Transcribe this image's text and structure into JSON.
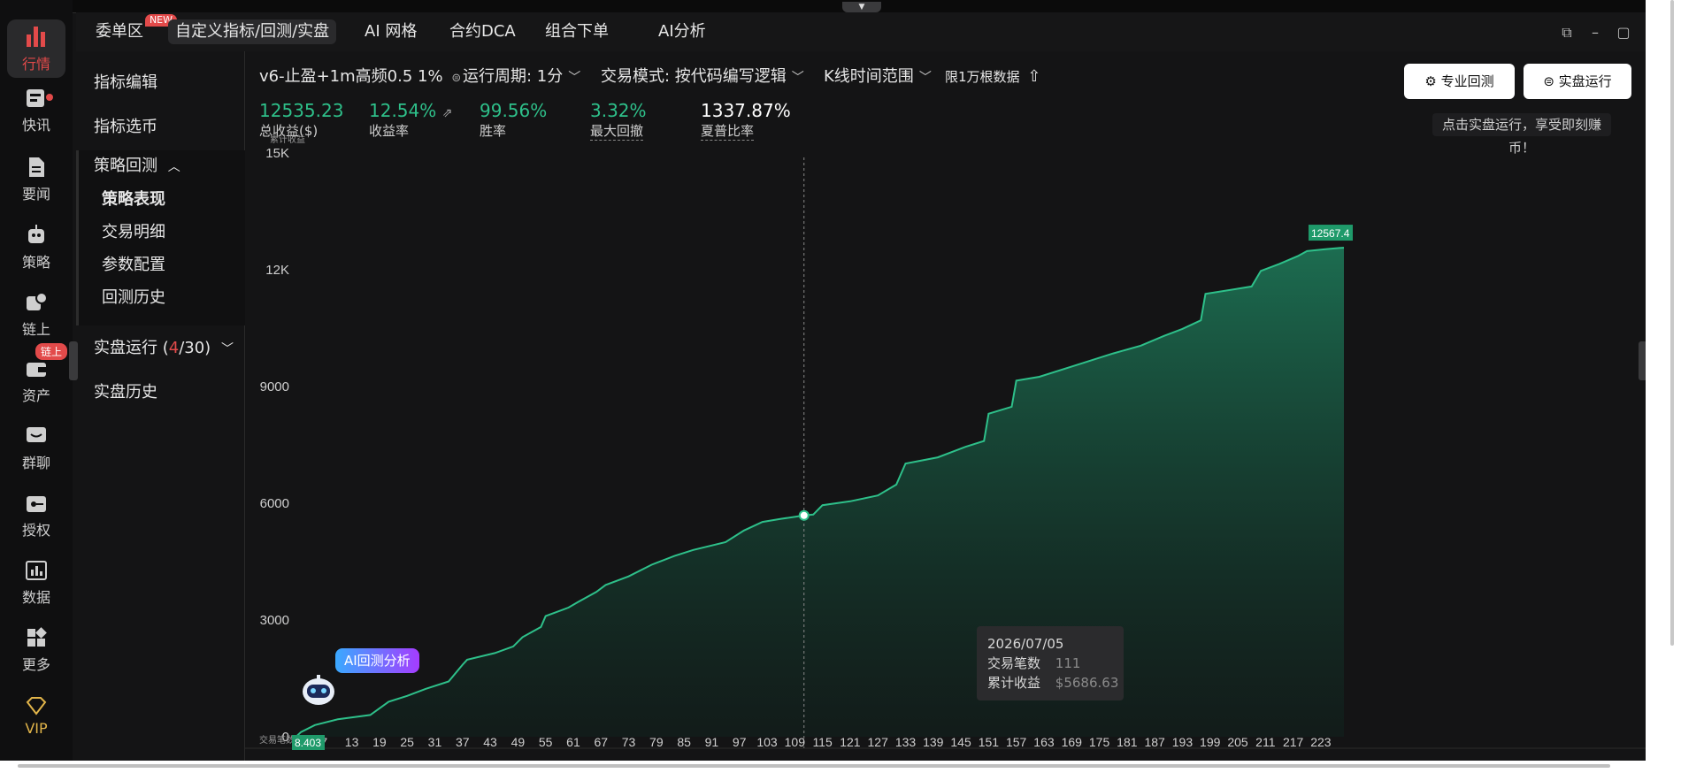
{
  "rail": {
    "items": [
      {
        "label": "行情",
        "icon": "bar-chart-icon",
        "active": true
      },
      {
        "label": "快讯",
        "icon": "news-icon",
        "dot": true
      },
      {
        "label": "要闻",
        "icon": "document-icon"
      },
      {
        "label": "策略",
        "icon": "robot-icon"
      },
      {
        "label": "链上",
        "icon": "chain-icon"
      },
      {
        "label": "资产",
        "icon": "wallet-icon",
        "badge": "链上"
      },
      {
        "label": "群聊",
        "icon": "chat-icon"
      },
      {
        "label": "授权",
        "icon": "key-icon"
      },
      {
        "label": "数据",
        "icon": "data-icon"
      },
      {
        "label": "更多",
        "icon": "grid-icon"
      },
      {
        "label": "VIP",
        "icon": "diamond-icon"
      }
    ]
  },
  "tabs": [
    {
      "label": "委单区",
      "badge": "NEW"
    },
    {
      "label": "自定义指标/回测/实盘",
      "active": true
    },
    {
      "label": "AI 网格"
    },
    {
      "label": "合约DCA"
    },
    {
      "label": "组合下单"
    },
    {
      "label": "AI分析"
    }
  ],
  "leftnav": {
    "indicator_edit": "指标编辑",
    "indicator_pick": "指标选币",
    "backtest": "策略回测",
    "backtest_subs": [
      "策略表现",
      "交易明细",
      "参数配置",
      "回测历史"
    ],
    "live_run": "实盘运行 (",
    "live_count": "4",
    "live_total": "/30)",
    "live_history": "实盘历史"
  },
  "controls": {
    "strategy": "v6-止盈+1m高频0.5 1%",
    "period": "运行周期: 1分",
    "mode": "交易模式: 按代码编写逻辑",
    "kline_range": "K线时间范围",
    "limit": "限1万根数据"
  },
  "buttons": {
    "pro_backtest": "专业回测",
    "live_run": "实盘运行",
    "hint": "点击实盘运行，享受即刻赚币！"
  },
  "stats": [
    {
      "value": "12535.23",
      "label": "总收益($)",
      "color": "#2ec08a"
    },
    {
      "value": "12.54%",
      "label": "收益率",
      "color": "#2ec08a"
    },
    {
      "value": "99.56%",
      "label": "胜率",
      "color": "#2ec08a"
    },
    {
      "value": "3.32%",
      "label": "最大回撤",
      "color": "#2ec08a"
    },
    {
      "value": "1337.87%",
      "label": "夏普比率",
      "color": "#ffffff"
    }
  ],
  "tooltip": {
    "date": "2026/07/05",
    "trades_label": "交易笔数",
    "trades_value": "111",
    "cum_label": "累计收益",
    "cum_value": "$5686.63"
  },
  "ai_badge": "AI回测分析",
  "chart_data": {
    "type": "area",
    "ylabel": "累计收益",
    "xlabel": "交易笔数",
    "ylim": [
      0,
      15000
    ],
    "yticks": [
      0,
      3000,
      6000,
      9000,
      12000,
      15000
    ],
    "ytick_labels": [
      "0",
      "3000",
      "6000",
      "9000",
      "12K",
      "15K"
    ],
    "xlim": [
      1,
      228
    ],
    "xtick_labels": [
      "7",
      "13",
      "19",
      "25",
      "31",
      "37",
      "43",
      "49",
      "55",
      "61",
      "67",
      "73",
      "79",
      "85",
      "91",
      "97",
      "103",
      "109",
      "115",
      "121",
      "127",
      "133",
      "139",
      "145",
      "151",
      "157",
      "163",
      "169",
      "175",
      "181",
      "187",
      "193",
      "199",
      "205",
      "211",
      "217",
      "223"
    ],
    "x_start_label": "8.403",
    "last_label": "12567.4",
    "highlight": {
      "x": 111,
      "y": 5686.63
    },
    "line_color": "#2ec08a",
    "x": [
      1,
      2,
      5,
      10,
      17,
      21,
      25,
      29,
      34,
      37,
      38,
      44,
      48,
      50,
      54,
      55,
      60,
      62,
      66,
      68,
      73,
      78,
      83,
      87,
      94,
      98,
      102,
      106,
      109,
      111,
      113,
      115,
      121,
      127,
      131,
      133,
      140,
      146,
      150,
      151,
      156,
      157,
      162,
      170,
      178,
      184,
      189,
      193,
      197,
      198,
      208,
      210,
      214,
      218,
      220,
      224,
      227,
      228
    ],
    "y": [
      10,
      120,
      300,
      450,
      560,
      900,
      1050,
      1230,
      1420,
      1850,
      1980,
      2150,
      2320,
      2560,
      2820,
      3100,
      3320,
      3460,
      3720,
      3900,
      4120,
      4420,
      4650,
      4800,
      5000,
      5300,
      5520,
      5600,
      5650,
      5686,
      5710,
      5950,
      6050,
      6200,
      6480,
      7020,
      7180,
      7450,
      7600,
      8300,
      8480,
      9150,
      9250,
      9550,
      9850,
      10050,
      10300,
      10480,
      10700,
      11380,
      11570,
      11970,
      12150,
      12350,
      12480,
      12530,
      12560,
      12567
    ]
  },
  "colors": {
    "accent": "#2ec08a",
    "alert": "#e24a4a",
    "panel": "#141415"
  }
}
